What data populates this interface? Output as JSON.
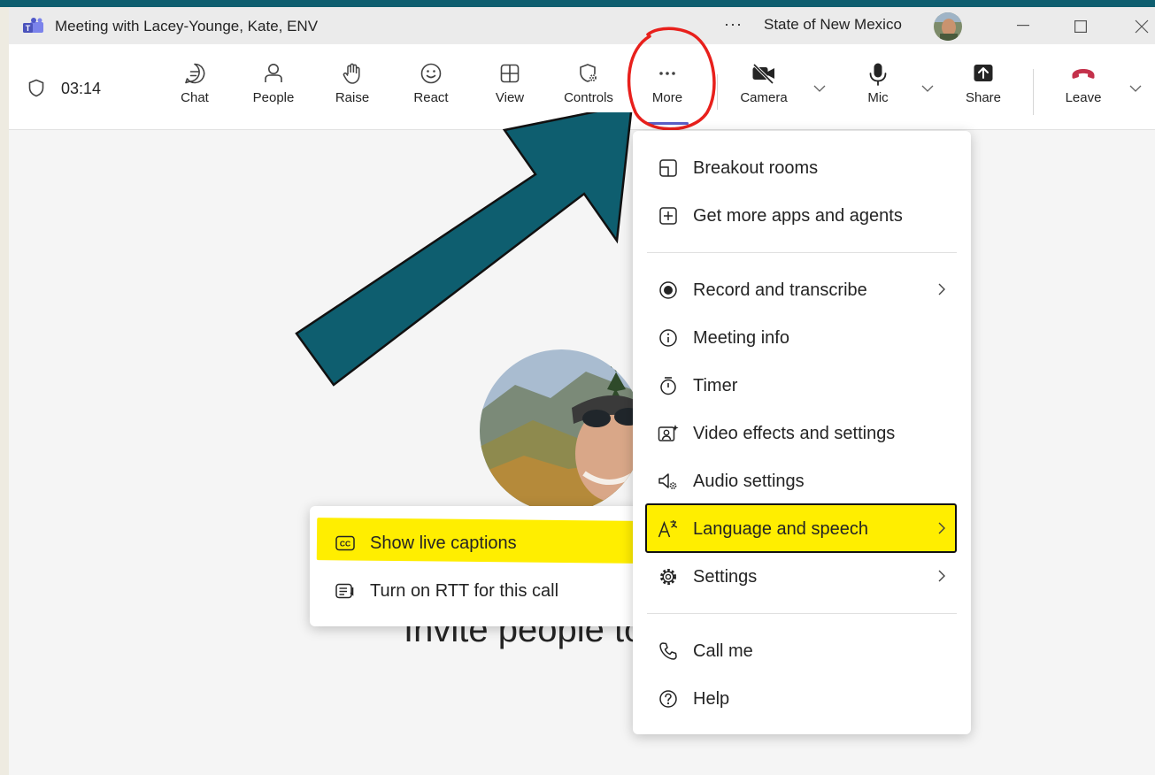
{
  "window": {
    "title": "Meeting with Lacey-Younge, Kate, ENV",
    "more_dots": "···",
    "org": "State of New Mexico"
  },
  "toolbar": {
    "timer": "03:14",
    "buttons": [
      {
        "label": "Chat",
        "icon": "chat-icon"
      },
      {
        "label": "People",
        "icon": "people-icon"
      },
      {
        "label": "Raise",
        "icon": "raise-hand-icon"
      },
      {
        "label": "React",
        "icon": "smiley-icon"
      },
      {
        "label": "View",
        "icon": "grid-icon"
      },
      {
        "label": "Controls",
        "icon": "shield-gear-icon"
      },
      {
        "label": "More",
        "icon": "more-dots-icon"
      },
      {
        "label": "Camera",
        "icon": "camera-off-icon"
      },
      {
        "label": "Mic",
        "icon": "mic-icon"
      },
      {
        "label": "Share",
        "icon": "share-icon"
      },
      {
        "label": "Leave",
        "icon": "hangup-icon"
      }
    ]
  },
  "more_menu": {
    "items": [
      {
        "label": "Breakout rooms",
        "icon": "breakout-icon"
      },
      {
        "label": "Get more apps and agents",
        "icon": "add-app-icon"
      },
      {
        "label": "Record and transcribe",
        "icon": "record-icon",
        "submenu": true
      },
      {
        "label": "Meeting info",
        "icon": "info-icon"
      },
      {
        "label": "Timer",
        "icon": "timer-icon"
      },
      {
        "label": "Video effects and settings",
        "icon": "video-effects-icon"
      },
      {
        "label": "Audio settings",
        "icon": "audio-settings-icon"
      },
      {
        "label": "Language and speech",
        "icon": "language-icon",
        "submenu": true
      },
      {
        "label": "Settings",
        "icon": "gear-icon",
        "submenu": true
      },
      {
        "label": "Call me",
        "icon": "phone-icon"
      },
      {
        "label": "Help",
        "icon": "help-icon"
      }
    ]
  },
  "submenu": {
    "items": [
      {
        "label": "Show live captions",
        "icon": "captions-icon"
      },
      {
        "label": "Turn on RTT for this call",
        "icon": "rtt-icon"
      }
    ]
  },
  "stage": {
    "invite_text": "Invite people to"
  },
  "colors": {
    "teal_arrow": "#0e5e6f",
    "highlight": "#ffee00",
    "annotation_circle": "#e8201c",
    "leave_red": "#c4314b",
    "accent_purple": "#5b5fc7"
  }
}
